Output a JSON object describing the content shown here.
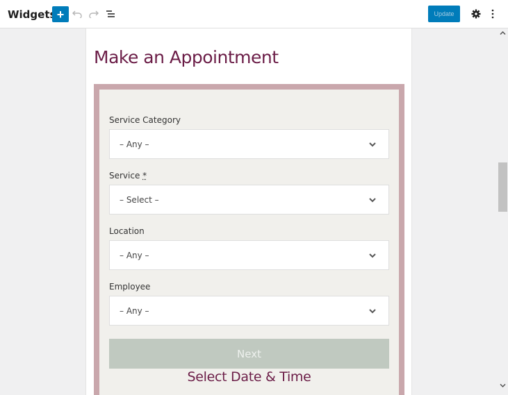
{
  "header": {
    "title": "Widgets",
    "add_label": "+",
    "update_label": "Update"
  },
  "icons": {
    "add": "plus-icon",
    "undo": "undo-icon",
    "redo": "redo-icon",
    "outline": "list-view-icon",
    "settings": "gear-icon",
    "more": "kebab-menu-icon"
  },
  "colors": {
    "accent": "#007cba",
    "heading": "#6b1d47",
    "frame": "#c9a7ac",
    "next_button": "#c0c9c0"
  },
  "widget": {
    "title": "Make an Appointment",
    "fields": [
      {
        "label": "Service Category",
        "required": "",
        "value": "– Any –"
      },
      {
        "label": "Service ",
        "required": "*",
        "value": "– Select –"
      },
      {
        "label": "Location",
        "required": "",
        "value": "– Any –"
      },
      {
        "label": "Employee",
        "required": "",
        "value": "– Any –"
      }
    ],
    "next_label": "Next",
    "step_title": "Select Date & Time"
  }
}
